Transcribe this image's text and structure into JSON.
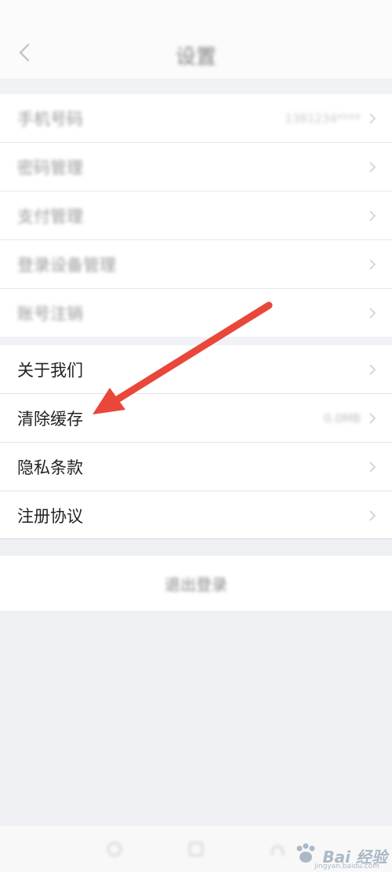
{
  "header": {
    "back_icon": "chevron-left-icon",
    "title": "设置"
  },
  "group1": {
    "items": [
      {
        "label": "手机号码",
        "value": "1381234****",
        "icon": "chevron-right-icon"
      },
      {
        "label": "密码管理",
        "icon": "chevron-right-icon"
      },
      {
        "label": "支付管理",
        "icon": "chevron-right-icon"
      },
      {
        "label": "登录设备管理",
        "icon": "chevron-right-icon"
      },
      {
        "label": "账号注销",
        "icon": "chevron-right-icon"
      }
    ]
  },
  "group2": {
    "items": [
      {
        "label": "关于我们",
        "icon": "chevron-right-icon"
      },
      {
        "label": "清除缓存",
        "value": "0.0MB",
        "icon": "chevron-right-icon"
      },
      {
        "label": "隐私条款",
        "icon": "chevron-right-icon"
      },
      {
        "label": "注册协议",
        "icon": "chevron-right-icon"
      }
    ]
  },
  "logout": {
    "label": "退出登录"
  },
  "annotation": {
    "arrow_color": "#e8473a",
    "points_to": "清除缓存"
  },
  "watermark": {
    "text": "Bai 经验",
    "sub": "jingyan.baidu.com"
  },
  "colors": {
    "page_bg": "#eef0f4",
    "row_bg": "#ffffff",
    "arrow": "#e8473a"
  }
}
